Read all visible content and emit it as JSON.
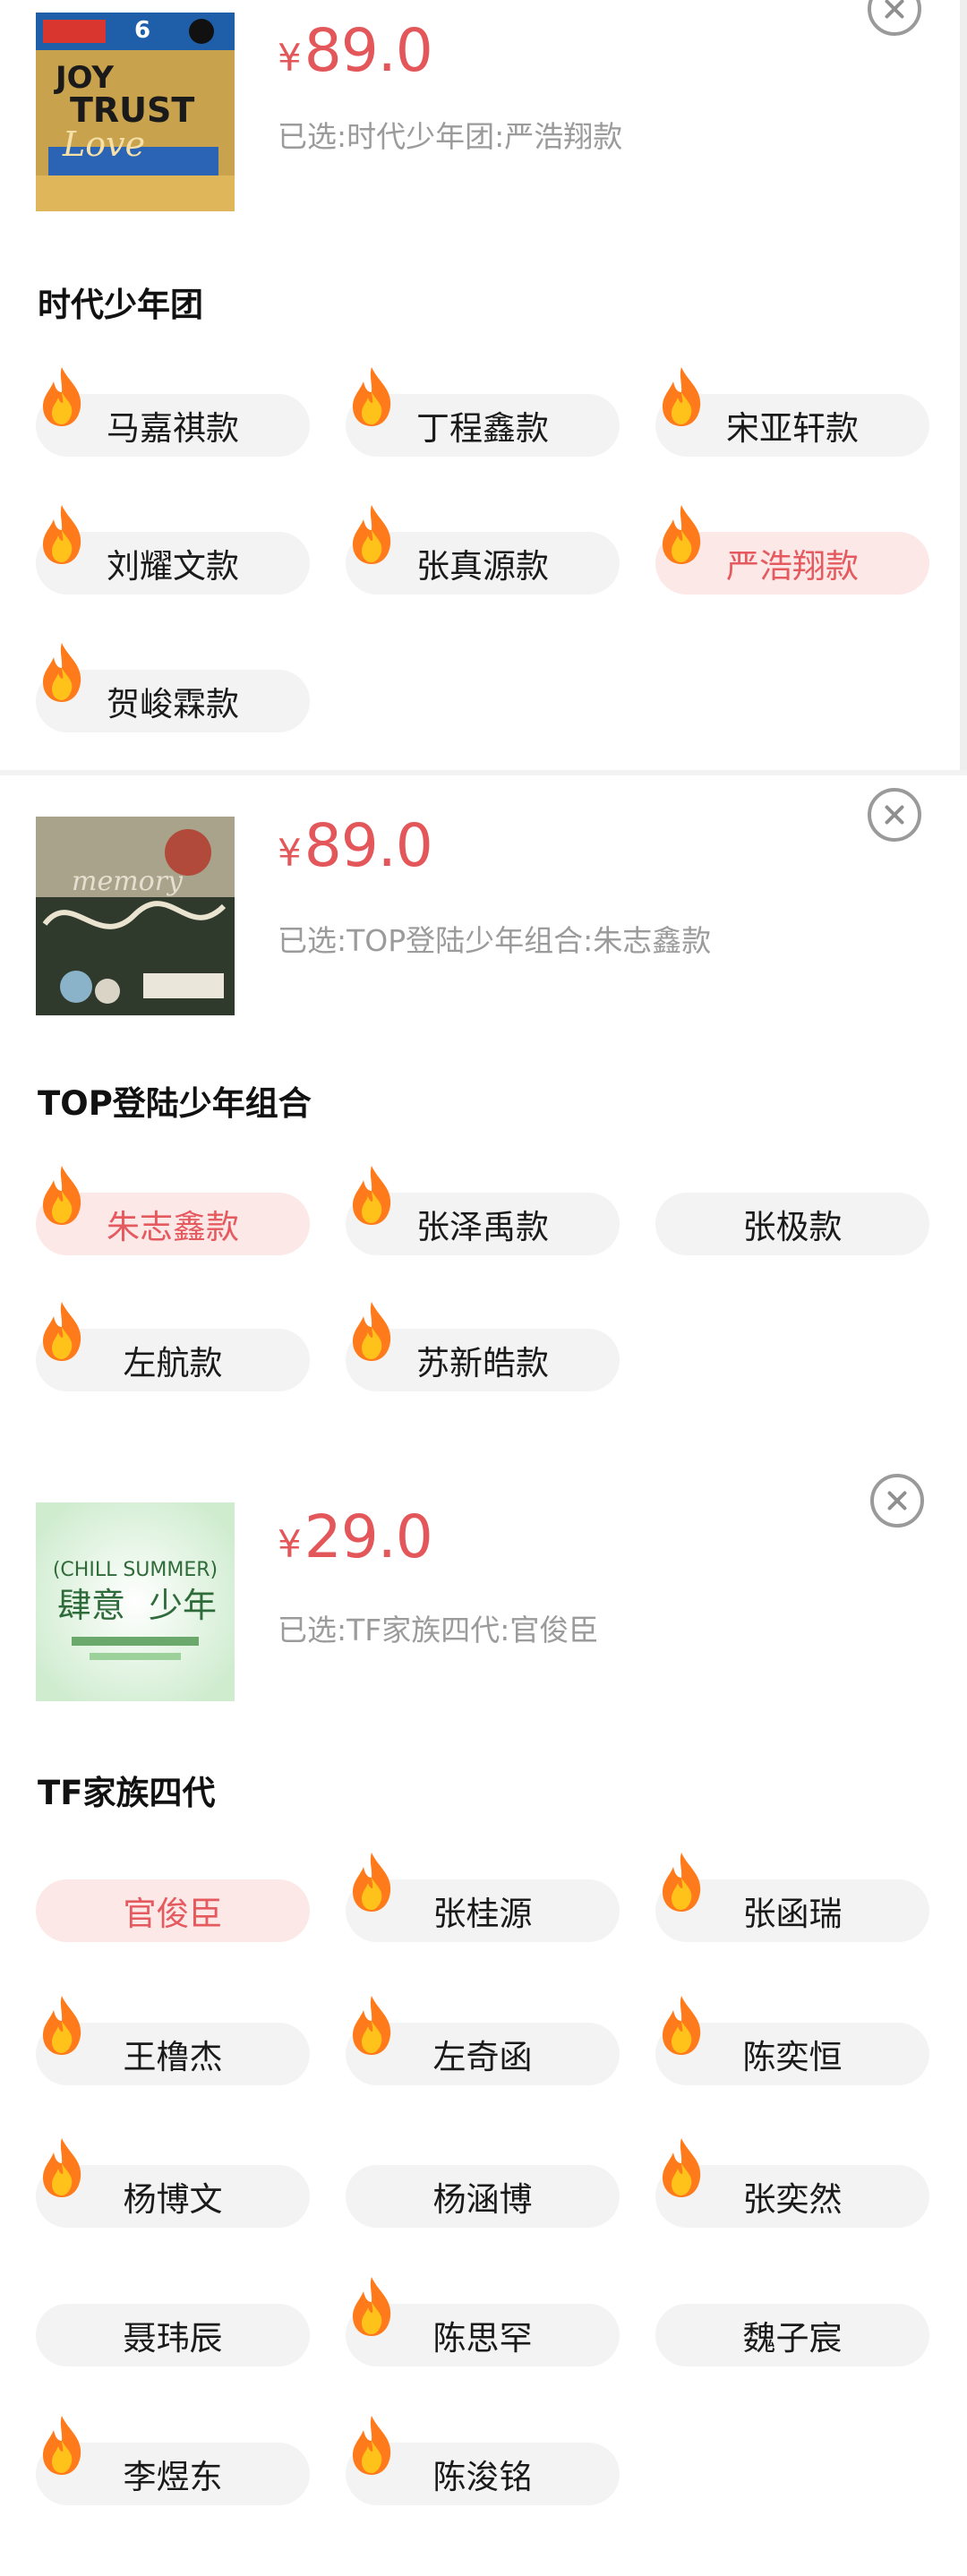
{
  "products": [
    {
      "currency": "¥",
      "price": "89.0",
      "selected_text": "已选:时代少年团:严浩翔款",
      "album_text": [
        "JOY",
        "TRUST",
        "Love",
        "6"
      ],
      "group_title": "时代少年团",
      "options": [
        {
          "label": "马嘉祺款",
          "hot": true,
          "selected": false
        },
        {
          "label": "丁程鑫款",
          "hot": true,
          "selected": false
        },
        {
          "label": "宋亚轩款",
          "hot": true,
          "selected": false
        },
        {
          "label": "刘耀文款",
          "hot": true,
          "selected": false
        },
        {
          "label": "张真源款",
          "hot": true,
          "selected": false
        },
        {
          "label": "严浩翔款",
          "hot": true,
          "selected": true
        },
        {
          "label": "贺峻霖款",
          "hot": true,
          "selected": false
        }
      ]
    },
    {
      "currency": "¥",
      "price": "89.0",
      "selected_text": "已选:TOP登陆少年组合:朱志鑫款",
      "album_text": [
        "memory"
      ],
      "group_title": "TOP登陆少年组合",
      "options": [
        {
          "label": "朱志鑫款",
          "hot": true,
          "selected": true
        },
        {
          "label": "张泽禹款",
          "hot": true,
          "selected": false
        },
        {
          "label": "张极款",
          "hot": false,
          "selected": false
        },
        {
          "label": "左航款",
          "hot": true,
          "selected": false
        },
        {
          "label": "苏新皓款",
          "hot": true,
          "selected": false
        }
      ]
    },
    {
      "currency": "¥",
      "price": "29.0",
      "selected_text": "已选:TF家族四代:官俊臣",
      "album_text": [
        "(CHILL SUMMER)",
        "肆意",
        "少年"
      ],
      "group_title": "TF家族四代",
      "options": [
        {
          "label": "官俊臣",
          "hot": false,
          "selected": true
        },
        {
          "label": "张桂源",
          "hot": true,
          "selected": false
        },
        {
          "label": "张函瑞",
          "hot": true,
          "selected": false
        },
        {
          "label": "王橹杰",
          "hot": true,
          "selected": false
        },
        {
          "label": "左奇函",
          "hot": true,
          "selected": false
        },
        {
          "label": "陈奕恒",
          "hot": true,
          "selected": false
        },
        {
          "label": "杨博文",
          "hot": true,
          "selected": false
        },
        {
          "label": "杨涵博",
          "hot": false,
          "selected": false
        },
        {
          "label": "张奕然",
          "hot": true,
          "selected": false
        },
        {
          "label": "聂玮辰",
          "hot": false,
          "selected": false
        },
        {
          "label": "陈思罕",
          "hot": true,
          "selected": false
        },
        {
          "label": "魏子宸",
          "hot": false,
          "selected": false
        },
        {
          "label": "李煜东",
          "hot": true,
          "selected": false
        },
        {
          "label": "陈浚铭",
          "hot": true,
          "selected": false
        }
      ]
    }
  ],
  "colors": {
    "price": "#e3565a",
    "chip_bg": "#f3f3f3",
    "chip_selected_bg": "#fde8e8",
    "chip_selected_text": "#e55a5f",
    "flame": "#ff7a1a"
  },
  "icons": {
    "close": "close-icon",
    "hot": "flame-icon"
  }
}
